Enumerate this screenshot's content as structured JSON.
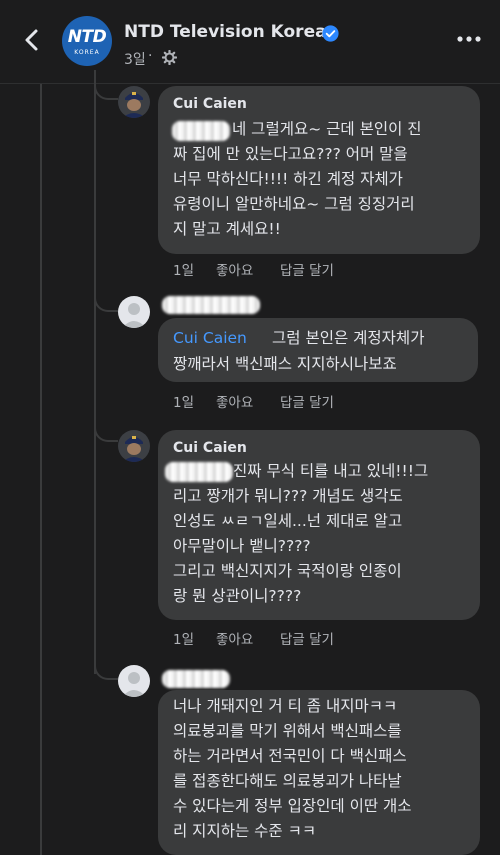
{
  "header": {
    "page_name": "NTD Television Korea",
    "logo_text": "NTD",
    "logo_subtext": "KOREA",
    "post_time": "3일",
    "meta_dot": "·",
    "icons": [
      "back-arrow-icon",
      "verified-badge-icon",
      "globe-gear-icon",
      "more-dots-icon"
    ]
  },
  "comments": [
    {
      "author": "Cui Caien",
      "lines": [
        "네 그럴게요~ 근데 본인이 진",
        "짜 집에 만 있는다고요??? 어머 말을",
        "너무 막하신다!!!! 하긴 계정 자체가",
        "유령이니 알만하네요~ 그럼 징징거리",
        "지 말고 계세요!!"
      ],
      "time": "1일",
      "like": "좋아요",
      "reply": "답글 달기"
    },
    {
      "author": "",
      "mention": "Cui Caien",
      "lines": [
        "그럼 본인은 계정자체가",
        "짱깨라서 백신패스 지지하시나보죠"
      ],
      "time": "1일",
      "like": "좋아요",
      "reply": "답글 달기"
    },
    {
      "author": "Cui Caien",
      "lines": [
        "진짜 무식 티를 내고 있네!!!그",
        "리고 짱개가 뭐니??? 개념도 생각도",
        "인성도 ㅆㄹㄱ일세...넌 제대로 알고",
        "아무말이나 뱉니????",
        "그리고 백신지지가 국적이랑 인종이",
        "랑 뭔 상관이니????"
      ],
      "time": "1일",
      "like": "좋아요",
      "reply": "답글 달기"
    },
    {
      "author": "",
      "lines": [
        "너나 개돼지인 거 티 좀 내지마ㅋㅋ",
        "의료붕괴를 막기 위해서 백신패스를",
        "하는 거라면서 전국민이 다 백신패스",
        "를 접종한다해도 의료붕괴가 나타날",
        "수 있다는게 정부 입장인데 이딴 개소",
        "리 지지하는 수준 ㅋㅋ"
      ]
    }
  ],
  "colors": {
    "background": "#1c1c1d",
    "bubble": "#3a3b3c",
    "text": "#e4e6eb",
    "secondary": "#b0b3b8",
    "mention": "#4599ff",
    "verified": "#2d88ff"
  }
}
